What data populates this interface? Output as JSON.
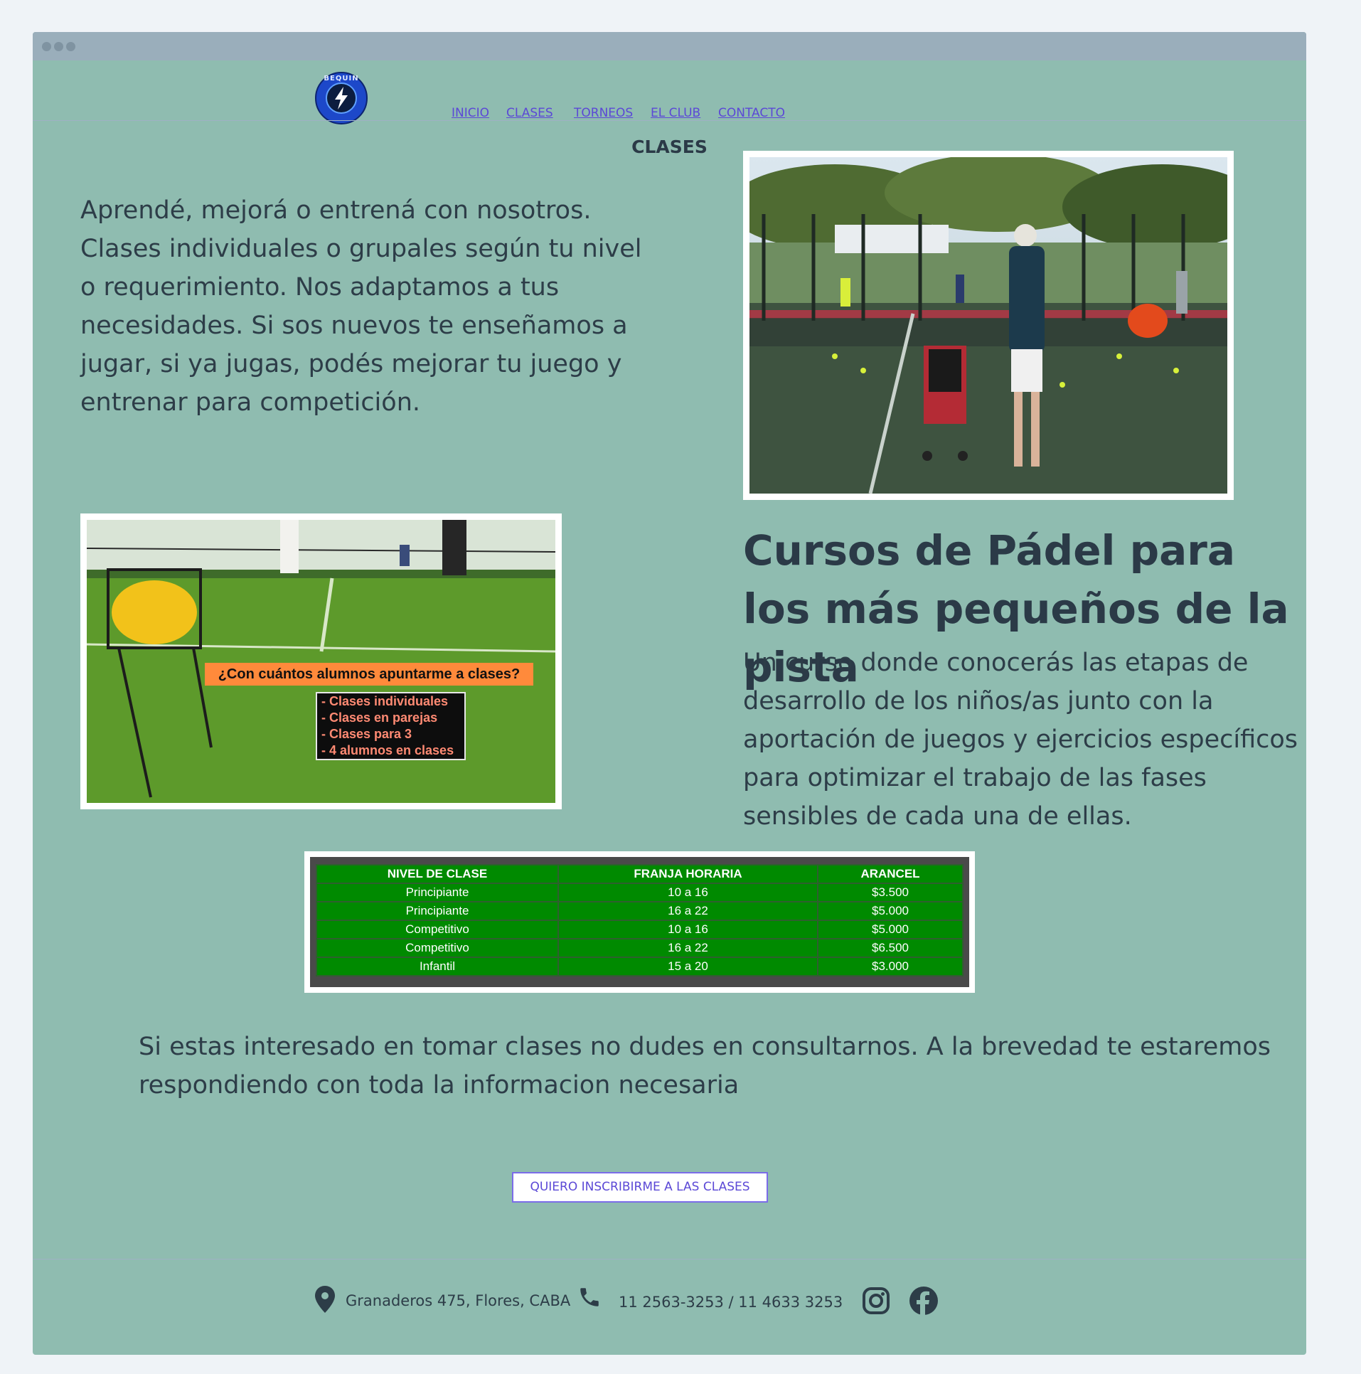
{
  "header": {
    "logo_text": "BEQUIN",
    "nav": [
      "INICIO",
      "CLASES",
      "TORNEOS",
      "EL CLUB",
      "CONTACTO"
    ]
  },
  "main": {
    "title": "CLASES",
    "intro": "Aprendé, mejorá o entrená con nosotros. Clases individuales o grupales según tu nivel o requerimiento. Nos adaptamos a tus necesidades. Si sos nuevos te enseñamos a jugar, si ya jugas, podés mejorar tu juego y entrenar para competición.",
    "image2": {
      "caption": "¿Con cuántos alumnos apuntarme a clases?",
      "list": [
        "- Clases individuales",
        "- Clases en parejas",
        "- Clases para 3",
        "- 4 alumnos en clases"
      ]
    },
    "cursos_title": "Cursos de Pádel para los más pequeños de la pista",
    "cursos_text": "Un curso donde conocerás las etapas de desarrollo de los niños/as junto con la aportación de juegos y ejercicios específicos para optimizar el trabajo de las fases sensibles de cada una de ellas.",
    "table": {
      "headers": [
        "NIVEL DE CLASE",
        "FRANJA HORARIA",
        "ARANCEL"
      ],
      "rows": [
        [
          "Principiante",
          "10 a 16",
          "$3.500"
        ],
        [
          "Principiante",
          "16 a 22",
          "$5.000"
        ],
        [
          "Competitivo",
          "10 a 16",
          "$5.000"
        ],
        [
          "Competitivo",
          "16 a 22",
          "$6.500"
        ],
        [
          "Infantil",
          "15 a 20",
          "$3.000"
        ]
      ]
    },
    "consult": "Si estas interesado en tomar clases no dudes en consultarnos. A la brevedad te estaremos respondiendo con toda la informacion necesaria",
    "cta": "QUIERO INSCRIBIRME A LAS CLASES"
  },
  "footer": {
    "address": "Granaderos 475, Flores, CABA",
    "phone": "11 2563-3253 / 11 4633 3253"
  },
  "colors": {
    "background": "#8fbcb0",
    "link": "#5b48d6",
    "text": "#2d3d48",
    "table_green": "#008a00"
  },
  "icons": [
    "map-pin-icon",
    "phone-icon",
    "instagram-icon",
    "facebook-icon"
  ]
}
